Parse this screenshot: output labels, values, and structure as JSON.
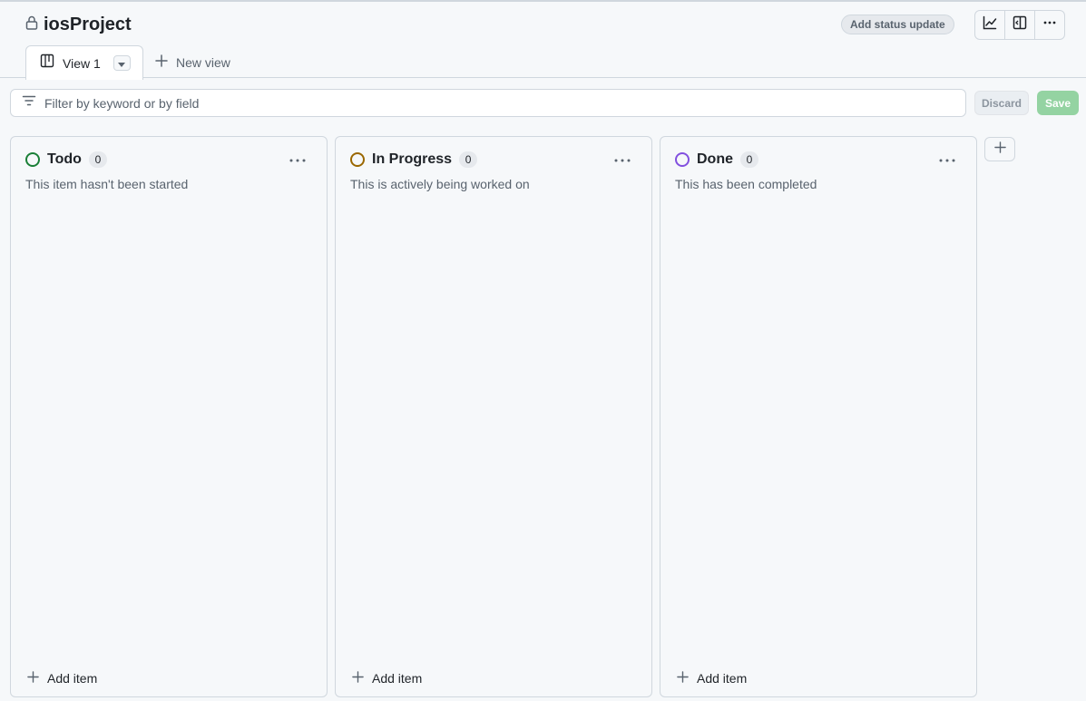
{
  "project": {
    "title": "iosProject"
  },
  "header": {
    "status_button": "Add status update"
  },
  "tabs": [
    {
      "label": "View 1",
      "active": true
    },
    {
      "label": "New view"
    }
  ],
  "filter": {
    "placeholder": "Filter by keyword or by field"
  },
  "actions": {
    "discard": "Discard",
    "save": "Save"
  },
  "columns": [
    {
      "title": "Todo",
      "count": "0",
      "description": "This item hasn't been started",
      "color": "#1a7f37",
      "add_label": "Add item"
    },
    {
      "title": "In Progress",
      "count": "0",
      "description": "This is actively being worked on",
      "color": "#9a6700",
      "add_label": "Add item"
    },
    {
      "title": "Done",
      "count": "0",
      "description": "This has been completed",
      "color": "#8250df",
      "add_label": "Add item"
    }
  ],
  "icons": {
    "lock": "lock-icon",
    "insights": "graph-icon",
    "panel": "sidebar-panel-icon",
    "more": "kebab-horizontal-icon",
    "board": "project-board-icon",
    "plus": "plus-icon",
    "filter": "filter-icon",
    "caret": "triangle-down-icon"
  },
  "colors": {
    "save_disabled": "#94d3a2",
    "border": "#d0d7de"
  }
}
